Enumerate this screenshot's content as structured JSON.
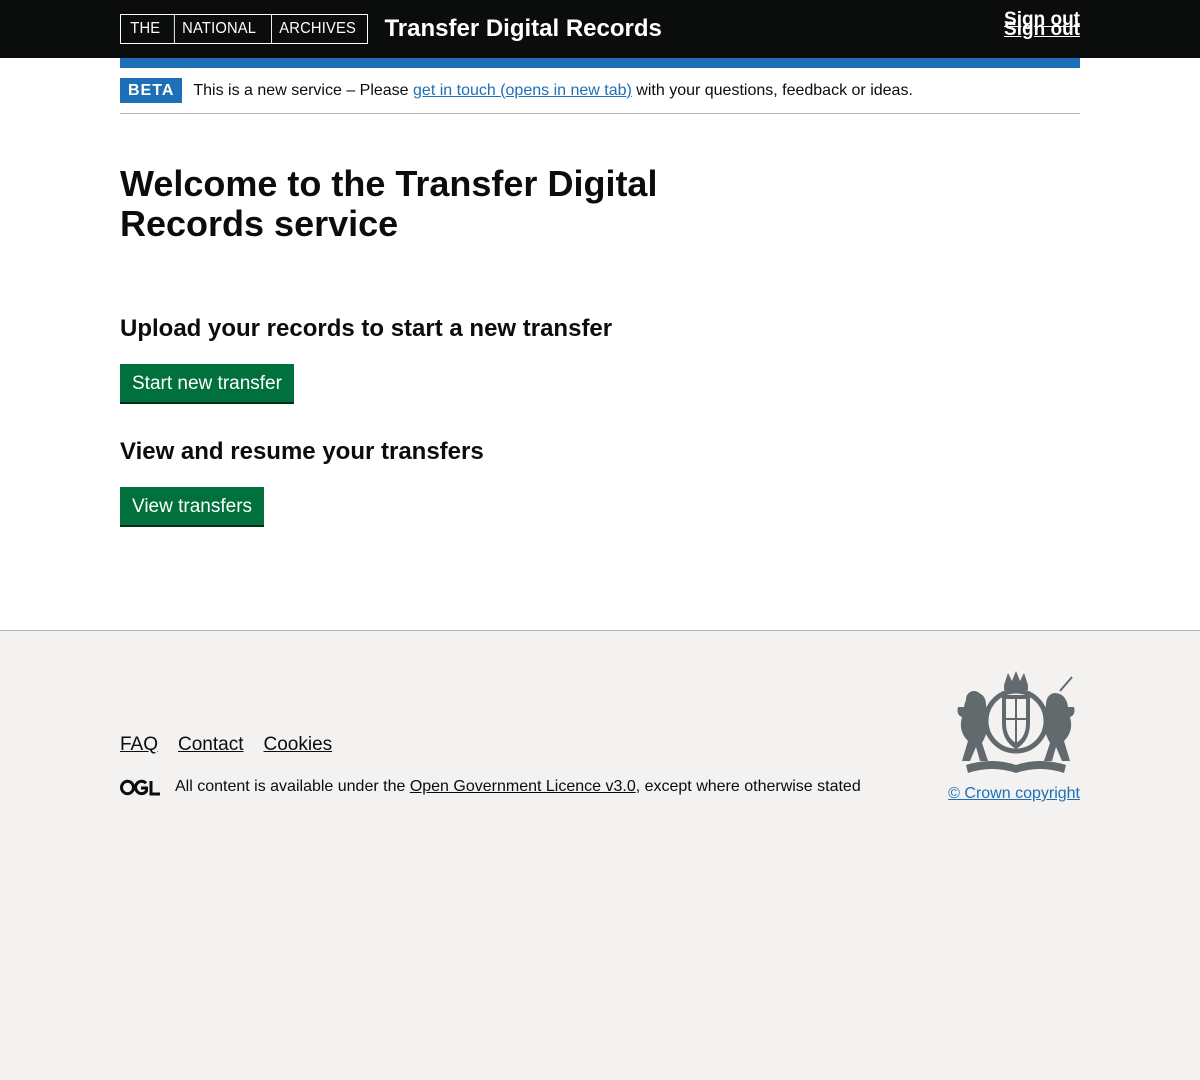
{
  "header": {
    "logo_parts": [
      "THE",
      "NATIONAL",
      "ARCHIVES"
    ],
    "service_name": "Transfer Digital Records",
    "sign_out": "Sign out"
  },
  "phase_banner": {
    "tag": "BETA",
    "text_before": "This is a new service – Please ",
    "link_text": "get in touch (opens in new tab)",
    "text_after": " with your questions, feedback or ideas."
  },
  "main": {
    "title": "Welcome to the Transfer Digital Records service",
    "upload_heading": "Upload your records to start a new transfer",
    "start_button": "Start new transfer",
    "view_heading": "View and resume your transfers",
    "view_button": "View transfers"
  },
  "footer": {
    "links": [
      "FAQ",
      "Contact",
      "Cookies"
    ],
    "licence_before": "All content is available under the ",
    "licence_link": "Open Government Licence v3.0",
    "licence_after": ", except where otherwise stated",
    "copyright": "© Crown copyright"
  },
  "colors": {
    "header_bg": "#0b0c0c",
    "brand_blue": "#1d70b8",
    "button_green": "#00703c",
    "footer_bg": "#f3f2f1"
  },
  "icons": [
    "ogl-logo-icon",
    "royal-coat-of-arms-icon"
  ]
}
